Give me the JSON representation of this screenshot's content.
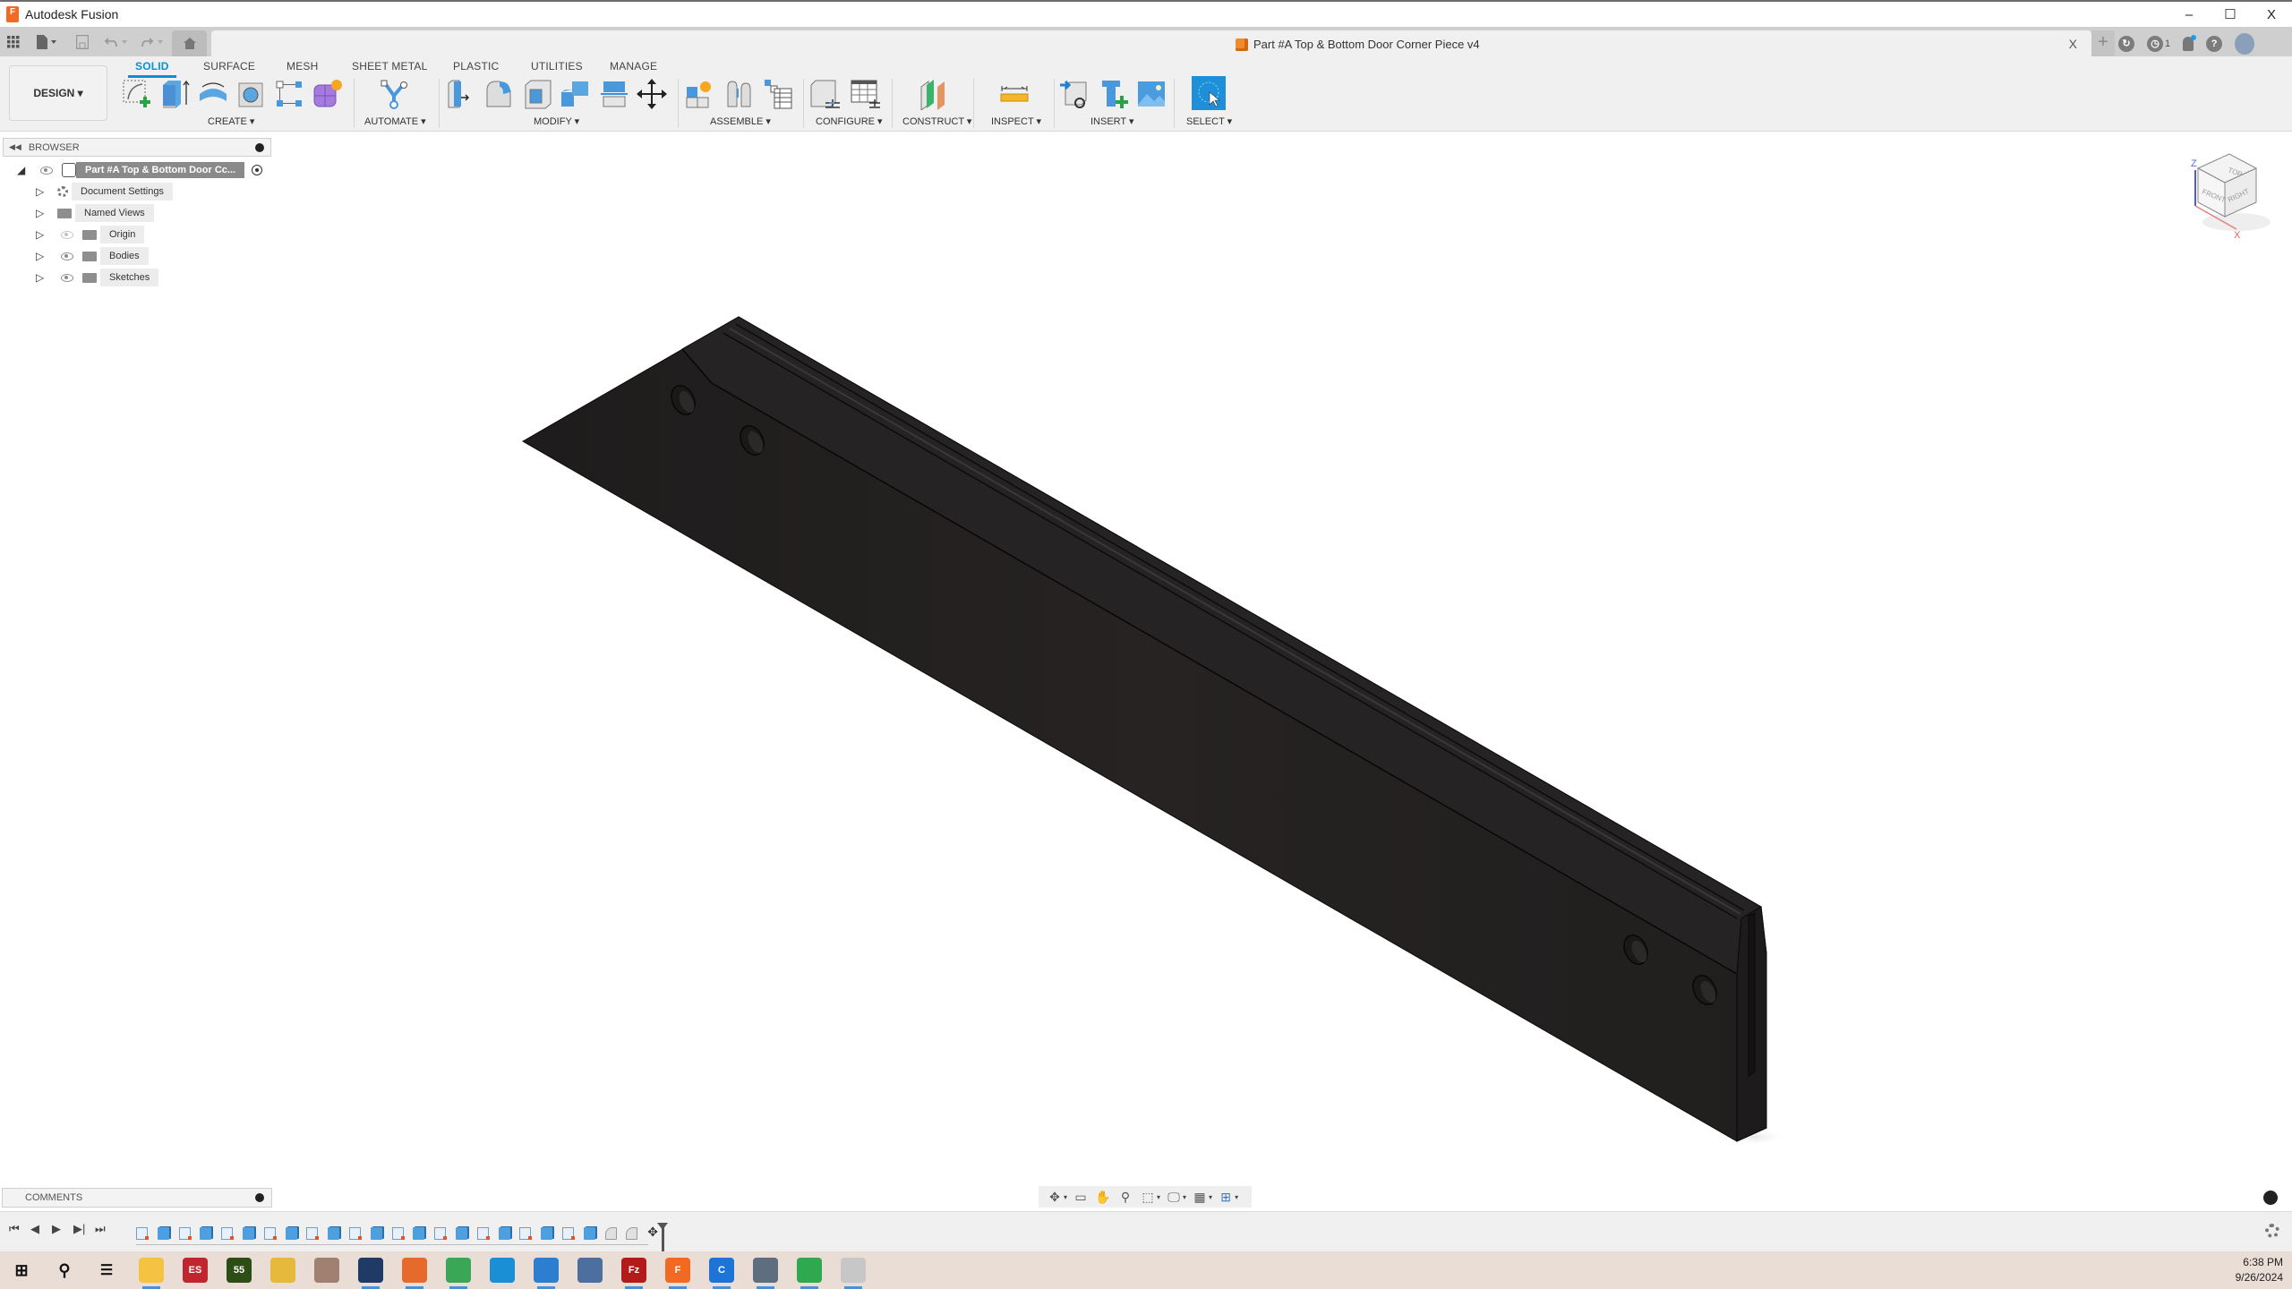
{
  "window": {
    "app_title": "Autodesk Fusion",
    "minimize_label": "–",
    "maximize_label": "☐",
    "close_label": "X"
  },
  "quick_access": {
    "grid_icon": "data-panel-icon",
    "file_icon": "file-icon",
    "save_icon": "save-icon",
    "undo_icon": "undo-icon",
    "redo_icon": "redo-icon",
    "home_icon": "home-icon"
  },
  "document_tab": {
    "title": "Part #A Top & Bottom Door Corner Piece v4",
    "close_label": "X",
    "new_tab_label": "+"
  },
  "header_right": {
    "job_status_count": "1"
  },
  "ribbon": {
    "workspace": "DESIGN",
    "tabs": [
      {
        "label": "SOLID",
        "active": true
      },
      {
        "label": "SURFACE",
        "active": false
      },
      {
        "label": "MESH",
        "active": false
      },
      {
        "label": "SHEET METAL",
        "active": false
      },
      {
        "label": "PLASTIC",
        "active": false
      },
      {
        "label": "UTILITIES",
        "active": false
      },
      {
        "label": "MANAGE",
        "active": false
      }
    ],
    "groups": [
      {
        "label": "CREATE ▾",
        "tools": [
          "create-sketch",
          "extrude",
          "revolve",
          "hole",
          "pattern",
          "create-form"
        ]
      },
      {
        "label": "AUTOMATE ▾",
        "tools": [
          "automate"
        ]
      },
      {
        "label": "MODIFY ▾",
        "tools": [
          "press-pull",
          "fillet",
          "shell",
          "combine",
          "offset-plane",
          "move-copy"
        ]
      },
      {
        "label": "ASSEMBLE ▾",
        "tools": [
          "new-component",
          "joint",
          "bill-of-materials"
        ]
      },
      {
        "label": "CONFIGURE ▾",
        "tools": [
          "configure-model",
          "configuration-table"
        ]
      },
      {
        "label": "CONSTRUCT ▾",
        "tools": [
          "midplane"
        ]
      },
      {
        "label": "INSPECT ▾",
        "tools": [
          "measure"
        ]
      },
      {
        "label": "INSERT ▾",
        "tools": [
          "insert-derive",
          "insert-mcmaster",
          "insert-canvas"
        ]
      },
      {
        "label": "SELECT ▾",
        "tools": [
          "select"
        ]
      }
    ]
  },
  "browser": {
    "title": "BROWSER",
    "root": "Part #A Top & Bottom Door Cc...",
    "items": [
      {
        "label": "Document Settings",
        "icon": "gear-icon",
        "visible": null
      },
      {
        "label": "Named Views",
        "icon": "folder-icon",
        "visible": null
      },
      {
        "label": "Origin",
        "icon": "folder-icon",
        "visible": false
      },
      {
        "label": "Bodies",
        "icon": "folder-icon",
        "visible": true
      },
      {
        "label": "Sketches",
        "icon": "folder-icon",
        "visible": true
      }
    ]
  },
  "viewcube": {
    "faces": [
      "TOP",
      "FRONT",
      "RIGHT"
    ],
    "axes": [
      "Z",
      "X"
    ]
  },
  "model": {
    "name": "Part #A Top & Bottom Door Corner Piece",
    "body_color": "#222020",
    "edge_color": "#0a0a0a"
  },
  "comments": {
    "title": "COMMENTS"
  },
  "nav_toolbar": {
    "tools": [
      "orbit",
      "look-at",
      "pan",
      "zoom",
      "fit",
      "display-settings",
      "grid-snaps",
      "viewports"
    ]
  },
  "timeline": {
    "controls": [
      "⏮",
      "◀",
      "▶",
      "▶|",
      "⏭"
    ],
    "features": [
      "sketch",
      "extrude",
      "sketch",
      "extrude",
      "sketch",
      "extrude",
      "sketch",
      "extrude",
      "sketch",
      "extrude",
      "sketch",
      "extrude",
      "sketch",
      "extrude",
      "sketch",
      "extrude",
      "sketch",
      "extrude",
      "sketch",
      "extrude",
      "sketch",
      "extrude",
      "fillet",
      "fillet",
      "move"
    ]
  },
  "taskbar": {
    "apps": [
      {
        "name": "file-explorer",
        "label": "",
        "color": "#f5c242",
        "active": true
      },
      {
        "name": "es",
        "label": "ES",
        "color": "#c0262d",
        "active": false
      },
      {
        "name": "app-55",
        "label": "55",
        "color": "#2d4d16",
        "active": false
      },
      {
        "name": "app-pen",
        "label": "",
        "color": "#e6b93d",
        "active": false
      },
      {
        "name": "app-colors",
        "label": "",
        "color": "#a08070",
        "active": false
      },
      {
        "name": "virtualbox",
        "label": "",
        "color": "#203a66",
        "active": true
      },
      {
        "name": "firefox",
        "label": "",
        "color": "#e66a2c",
        "active": true
      },
      {
        "name": "chrome",
        "label": "",
        "color": "#3aa757",
        "active": true
      },
      {
        "name": "edge",
        "label": "",
        "color": "#1a8fd6",
        "active": false
      },
      {
        "name": "vscode",
        "label": "",
        "color": "#2c7fd0",
        "active": true
      },
      {
        "name": "network",
        "label": "",
        "color": "#4d6f9f",
        "active": false
      },
      {
        "name": "filezilla",
        "label": "Fz",
        "color": "#b31b1b",
        "active": true
      },
      {
        "name": "fusion",
        "label": "F",
        "color": "#f26a21",
        "active": true
      },
      {
        "name": "app-c",
        "label": "C",
        "color": "#1e74d6",
        "active": true
      },
      {
        "name": "calculator",
        "label": "",
        "color": "#5e6e7e",
        "active": true
      },
      {
        "name": "spreadsheet",
        "label": "",
        "color": "#2fa84f",
        "active": true
      },
      {
        "name": "app-cat",
        "label": "",
        "color": "#c7c7c7",
        "active": true
      }
    ],
    "time": "6:38 PM",
    "date": "9/26/2024"
  }
}
